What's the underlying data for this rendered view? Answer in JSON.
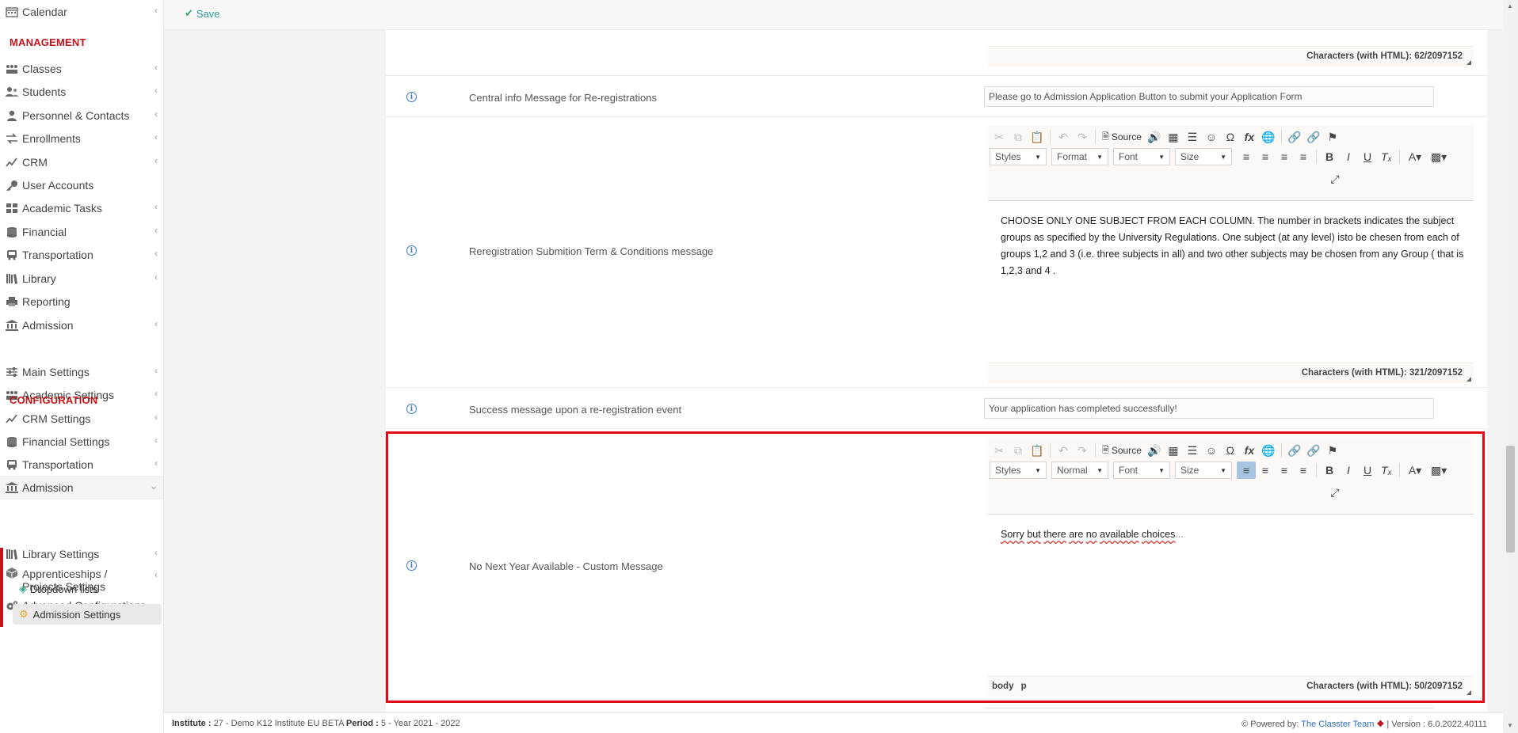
{
  "sidebar": {
    "items": [
      {
        "label": "Calendar",
        "icon": "calendar-icon"
      },
      {
        "label": "Classes",
        "icon": "classes-icon"
      },
      {
        "label": "Students",
        "icon": "students-icon"
      },
      {
        "label": "Personnel & Contacts",
        "icon": "personnel-icon"
      },
      {
        "label": "Enrollments",
        "icon": "enrollments-icon"
      },
      {
        "label": "CRM",
        "icon": "crm-icon"
      },
      {
        "label": "User Accounts",
        "icon": "key-icon"
      },
      {
        "label": "Academic Tasks",
        "icon": "tasks-icon"
      },
      {
        "label": "Financial",
        "icon": "financial-icon"
      },
      {
        "label": "Transportation",
        "icon": "bus-icon"
      },
      {
        "label": "Library",
        "icon": "library-icon"
      },
      {
        "label": "Reporting",
        "icon": "print-icon"
      },
      {
        "label": "Admission",
        "icon": "bank-icon"
      },
      {
        "label": "Main Settings",
        "icon": "sliders-icon"
      },
      {
        "label": "Academic Settings",
        "icon": "classes-icon"
      },
      {
        "label": "CRM Settings",
        "icon": "crm-icon"
      },
      {
        "label": "Financial Settings",
        "icon": "financial-icon"
      },
      {
        "label": "Transportation",
        "icon": "bus-icon"
      },
      {
        "label": "Admission",
        "icon": "bank-icon"
      },
      {
        "label": "Library Settings",
        "icon": "library-icon"
      },
      {
        "label": "Apprenticeships / Projects Settings",
        "icon": "cube-icon"
      },
      {
        "label": "Advanced Configurations",
        "icon": "gears-icon"
      }
    ],
    "sections": {
      "management": "MANAGEMENT",
      "configuration": "CONFIGURATION"
    },
    "subitems": [
      {
        "label": "Dropdown lists",
        "icon": "layers-icon"
      },
      {
        "label": "Admission Settings",
        "icon": "gear-icon"
      }
    ]
  },
  "toolbar": {
    "save_label": "Save"
  },
  "settings": {
    "row0_count": "Characters (with HTML): 62/2097152",
    "central_label": "Central info Message for Re-registrations",
    "central_value": "Please go to Admission Application Button to submit your Application Form",
    "terms_label": "Reregistration Submition Term & Conditions message",
    "terms_body": "CHOOSE ONLY ONE SUBJECT FROM EACH COLUMN. The number in brackets indicates the subject groups as specified by the University Regulations. One subject (at any level) isto be chesen from each of groups 1,2 and 3 (i.e. three subjects in all) and two other subjects may be chosen from any Group ( that is 1,2,3 and 4 .",
    "terms_count": "Characters (with HTML): 321/2097152",
    "success_label": "Success message upon a re-registration event",
    "success_value": "Your application has completed successfully!",
    "nonext_label": "No Next Year Available - Custom Message",
    "nonext_words": [
      "Sorry",
      "but",
      "there",
      "are",
      "no",
      "available",
      "choices"
    ],
    "nonext_trail": "...",
    "nonext_path": "body p",
    "nonext_count": "Characters (with HTML): 50/2097152"
  },
  "editor": {
    "source_label": "Source",
    "styles": "Styles",
    "format_terms": "Format",
    "format_nonext": "Normal",
    "font": "Font",
    "size": "Size"
  },
  "footer": {
    "institute_label": "Institute :",
    "institute_value": "27 - Demo K12 Institute EU BETA",
    "period_label": "Period :",
    "period_value": "5 - Year 2021 - 2022",
    "powered": "Powered by:",
    "team": "The Classter Team",
    "version": "| Version : 6.0.2022.40111"
  },
  "colors": {
    "brand_red": "#c3151a",
    "highlight": "#e30914",
    "link": "#2a6ebb",
    "save": "#2f9a9b"
  }
}
